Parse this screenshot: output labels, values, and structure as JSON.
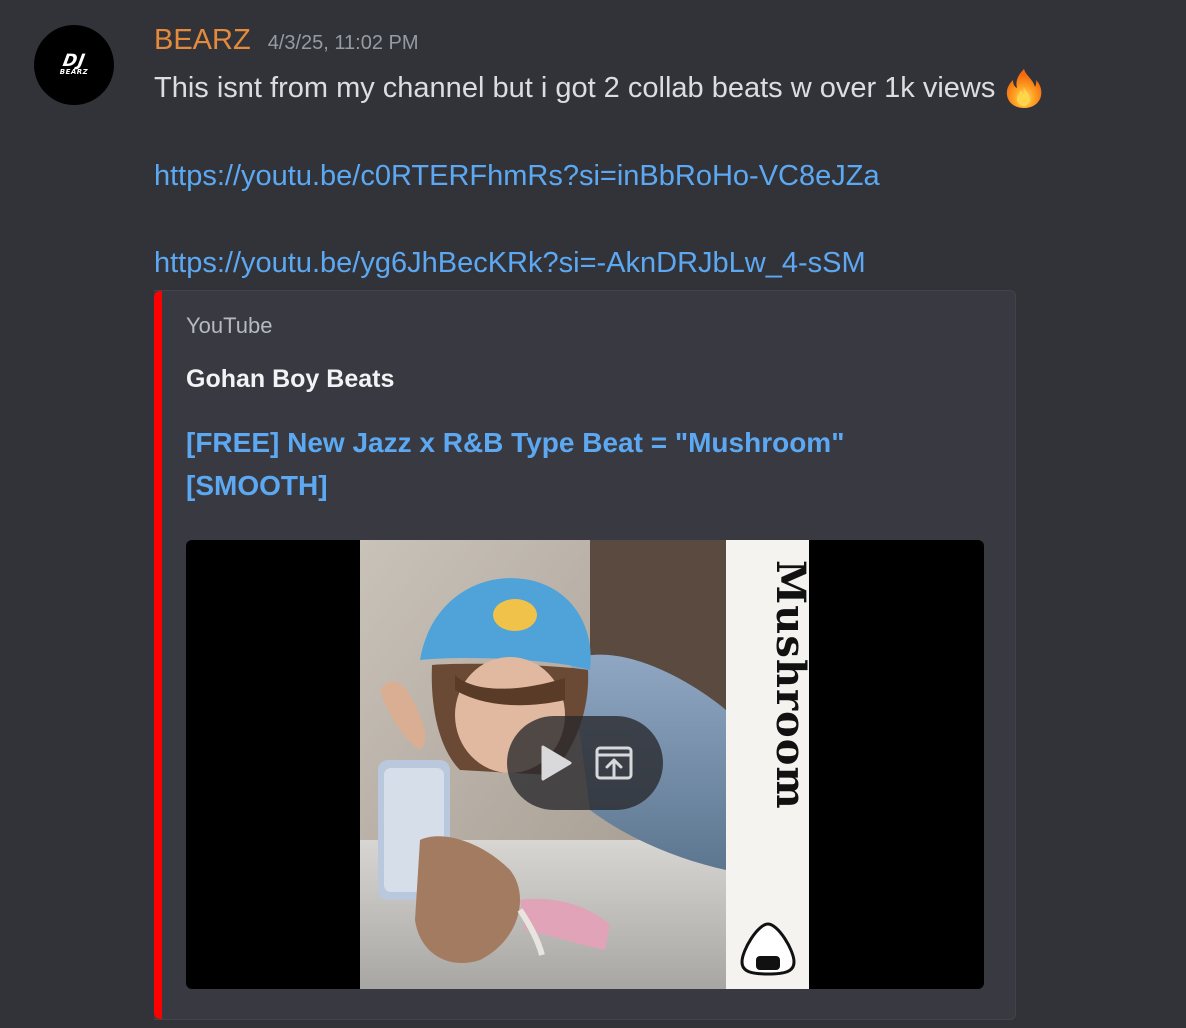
{
  "message": {
    "avatar": {
      "line1": "DJ",
      "line2": "BEARZ"
    },
    "username": "BEARZ",
    "username_color": "#e38a3c",
    "timestamp": "4/3/25, 11:02 PM",
    "text": "This isnt from my channel but i got 2 collab beats w over 1k views",
    "emoji": "fire-icon",
    "links": [
      "https://youtu.be/c0RTERFhmRs?si=inBbRoHo-VC8eJZa",
      "https://youtu.be/yg6JhBecKRk?si=-AknDRJbLw_4-sSM"
    ]
  },
  "embed": {
    "accent_color": "#ff0000",
    "provider": "YouTube",
    "author": "Gohan Boy Beats",
    "title": "[FREE] New Jazz x R&B Type Beat = \"Mushroom\" [SMOOTH]",
    "thumbnail": {
      "text": "Mushroom"
    },
    "controls": {
      "play": "play-icon",
      "open": "open-external-icon"
    }
  }
}
